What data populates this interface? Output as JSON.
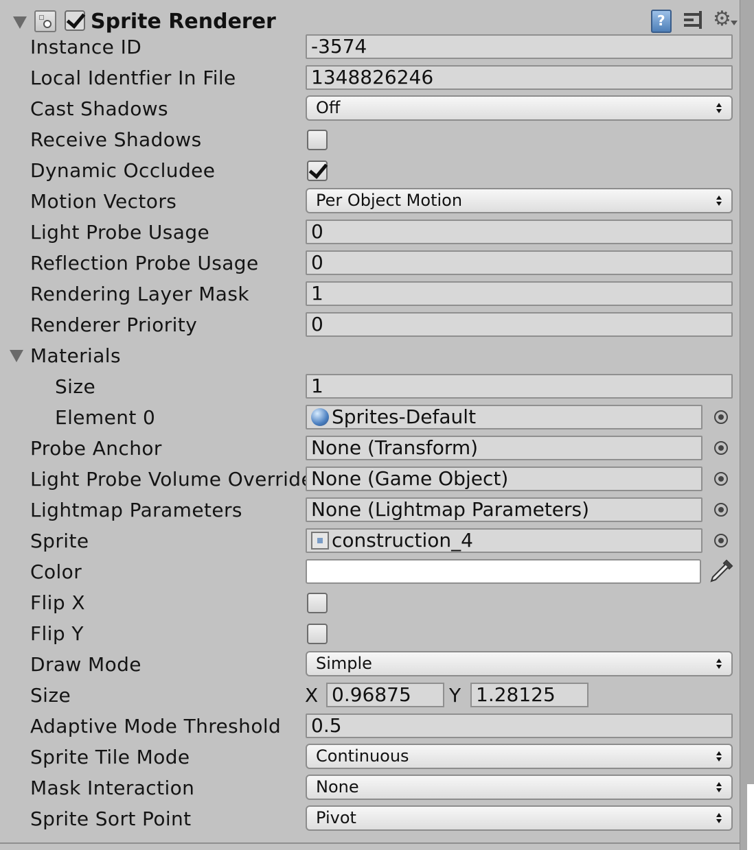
{
  "header": {
    "title": "Sprite Renderer",
    "enabled": true,
    "icons": [
      "component-icon",
      "help-book-icon",
      "presets-icon",
      "gear-icon"
    ]
  },
  "fields": {
    "instance_id": {
      "label": "Instance ID",
      "value": "-3574"
    },
    "local_identifier": {
      "label": "Local Identfier In File",
      "value": "1348826246"
    },
    "cast_shadows": {
      "label": "Cast Shadows",
      "value": "Off"
    },
    "receive_shadows": {
      "label": "Receive Shadows",
      "checked": false
    },
    "dynamic_occludee": {
      "label": "Dynamic Occludee",
      "checked": true
    },
    "motion_vectors": {
      "label": "Motion Vectors",
      "value": "Per Object Motion"
    },
    "light_probe_usage": {
      "label": "Light Probe Usage",
      "value": "0"
    },
    "reflection_probe_usage": {
      "label": "Reflection Probe Usage",
      "value": "0"
    },
    "rendering_layer_mask": {
      "label": "Rendering Layer Mask",
      "value": "1"
    },
    "renderer_priority": {
      "label": "Renderer Priority",
      "value": "0"
    },
    "materials": {
      "label": "Materials"
    },
    "materials_size": {
      "label": "Size",
      "value": "1"
    },
    "element_0": {
      "label": "Element 0",
      "value": "Sprites-Default"
    },
    "probe_anchor": {
      "label": "Probe Anchor",
      "value": "None (Transform)"
    },
    "light_probe_volume_override": {
      "label": "Light Probe Volume Override",
      "value": "None (Game Object)"
    },
    "lightmap_parameters": {
      "label": "Lightmap Parameters",
      "value": "None (Lightmap Parameters)"
    },
    "sprite": {
      "label": "Sprite",
      "value": "construction_4"
    },
    "color": {
      "label": "Color",
      "value": "#ffffff"
    },
    "flip_x": {
      "label": "Flip X",
      "checked": false
    },
    "flip_y": {
      "label": "Flip Y",
      "checked": false
    },
    "draw_mode": {
      "label": "Draw Mode",
      "value": "Simple"
    },
    "size": {
      "label": "Size",
      "x_label": "X",
      "x": "0.96875",
      "y_label": "Y",
      "y": "1.28125"
    },
    "adaptive_mode_threshold": {
      "label": "Adaptive Mode Threshold",
      "value": "0.5"
    },
    "sprite_tile_mode": {
      "label": "Sprite Tile Mode",
      "value": "Continuous"
    },
    "mask_interaction": {
      "label": "Mask Interaction",
      "value": "None"
    },
    "sprite_sort_point": {
      "label": "Sprite Sort Point",
      "value": "Pivot"
    }
  },
  "colors": {
    "panel_bg": "#c2c2c2",
    "field_bg": "#d8d8d8",
    "field_border": "#8f8f8f",
    "color_swatch": "#ffffff"
  }
}
